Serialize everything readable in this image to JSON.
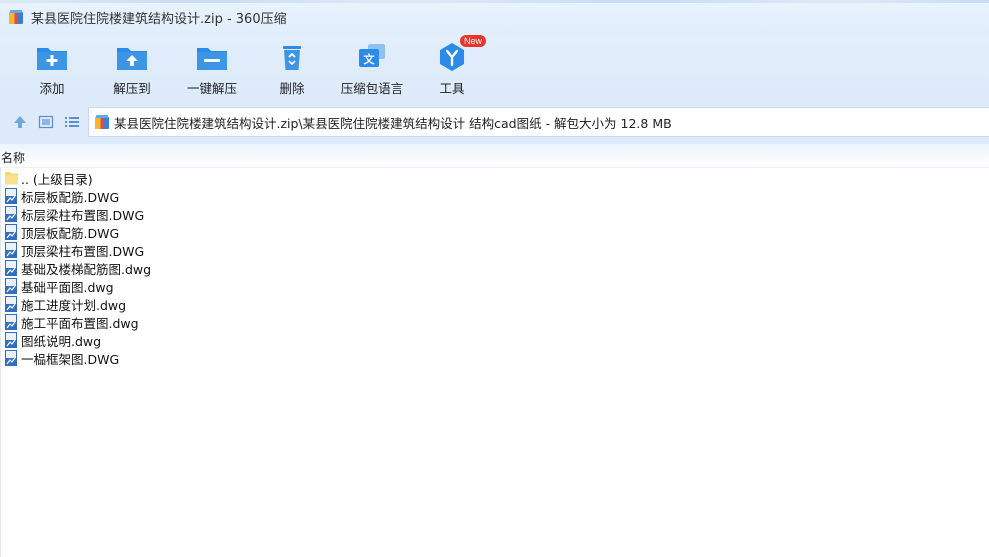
{
  "window": {
    "title": "某县医院住院楼建筑结构设计.zip - 360压缩"
  },
  "toolbar": {
    "buttons": [
      {
        "label": "添加",
        "icon": "folder-plus-icon"
      },
      {
        "label": "解压到",
        "icon": "folder-extract-icon"
      },
      {
        "label": "一键解压",
        "icon": "folder-oneclick-icon"
      },
      {
        "label": "删除",
        "icon": "recycle-bin-icon"
      },
      {
        "label": "压缩包语言",
        "icon": "language-icon"
      },
      {
        "label": "工具",
        "icon": "tools-icon",
        "badge": "New"
      }
    ]
  },
  "address": {
    "path": "某县医院住院楼建筑结构设计.zip\\某县医院住院楼建筑结构设计 结构cad图纸 - 解包大小为 12.8 MB"
  },
  "list": {
    "header_name": "名称",
    "rows": [
      {
        "label": ".. (上级目录)",
        "type": "parent-folder"
      },
      {
        "label": "标层板配筋.DWG",
        "type": "dwg"
      },
      {
        "label": "标层梁柱布置图.DWG",
        "type": "dwg"
      },
      {
        "label": "顶层板配筋.DWG",
        "type": "dwg"
      },
      {
        "label": "顶层梁柱布置图.DWG",
        "type": "dwg"
      },
      {
        "label": "基础及楼梯配筋图.dwg",
        "type": "dwg"
      },
      {
        "label": "基础平面图.dwg",
        "type": "dwg"
      },
      {
        "label": "施工进度计划.dwg",
        "type": "dwg"
      },
      {
        "label": "施工平面布置图.dwg",
        "type": "dwg"
      },
      {
        "label": "图纸说明.dwg",
        "type": "dwg"
      },
      {
        "label": "一榀框架图.DWG",
        "type": "dwg"
      }
    ]
  },
  "colors": {
    "accent": "#2c8ae8",
    "icon_blue": "#3d95e6",
    "badge_red": "#e8342b",
    "toolbar_bg": "#dceafa"
  }
}
